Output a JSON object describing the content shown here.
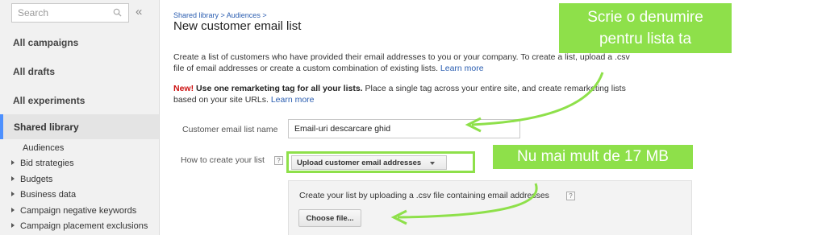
{
  "sidebar": {
    "search_placeholder": "Search",
    "collapse_glyph": "«",
    "nav": [
      {
        "label": "All campaigns"
      },
      {
        "label": "All drafts"
      },
      {
        "label": "All experiments"
      },
      {
        "label": "Shared library"
      }
    ],
    "sub_items": [
      {
        "label": "Audiences"
      },
      {
        "label": "Bid strategies"
      },
      {
        "label": "Budgets"
      },
      {
        "label": "Business data"
      },
      {
        "label": "Campaign negative keywords"
      },
      {
        "label": "Campaign placement exclusions"
      }
    ]
  },
  "main": {
    "breadcrumb": "Shared library > Audiences >",
    "title": "New customer email list",
    "description": "Create a list of customers who have provided their email addresses to you or your company. To create a list, upload a .csv file of email addresses or create a custom combination of existing lists.",
    "learn_more": "Learn more",
    "notice_new": "New!",
    "notice_bold": "Use one remarketing tag for all your lists.",
    "notice_text": "Place a single tag across your entire site, and create remarketing lists based on your site URLs.",
    "notice_learn_more": "Learn more",
    "name_label": "Customer email list name",
    "name_value": "Email-uri descarcare ghid",
    "create_label": "How to create your list",
    "help_glyph": "?",
    "create_option": "Upload customer email addresses",
    "upload_text": "Create your list by uploading a .csv file containing email addresses",
    "choose_file": "Choose file..."
  },
  "annotations": {
    "callout_top_line1": "Scrie o denumire",
    "callout_top_line2": "pentru lista ta",
    "callout_size": "Nu mai mult de 17 MB",
    "accent_color": "#8ee04a",
    "link_color": "#2a5db0"
  }
}
